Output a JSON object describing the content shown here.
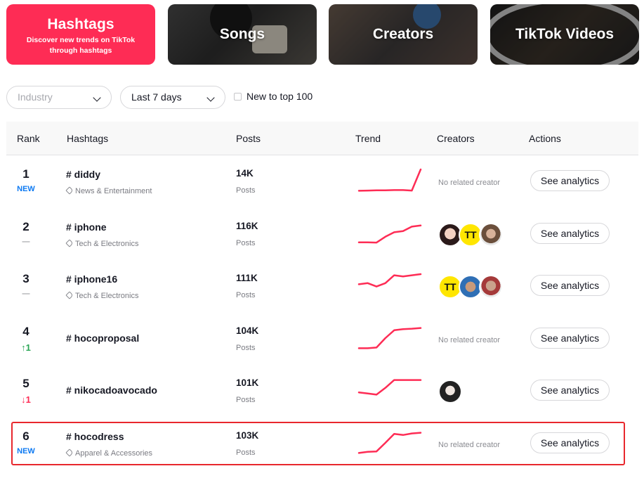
{
  "categories": [
    {
      "title": "Hashtags",
      "subtitle": "Discover new trends on TikTok through hashtags"
    },
    {
      "title": "Songs"
    },
    {
      "title": "Creators"
    },
    {
      "title": "TikTok Videos"
    }
  ],
  "filters": {
    "industry_placeholder": "Industry",
    "period_value": "Last 7 days",
    "new_to_top_label": "New to top 100",
    "new_to_top_checked": false
  },
  "table": {
    "headers": {
      "rank": "Rank",
      "hashtags": "Hashtags",
      "posts": "Posts",
      "trend": "Trend",
      "creators": "Creators",
      "actions": "Actions"
    },
    "posts_label": "Posts",
    "no_creator_text": "No related creator",
    "action_label": "See analytics",
    "rows": [
      {
        "rank": "1",
        "badge": "NEW",
        "badge_type": "new",
        "hashtag": "# diddy",
        "category": "News & Entertainment",
        "posts": "14K",
        "trend": [
          0.05,
          0.06,
          0.07,
          0.07,
          0.08,
          0.08,
          0.06,
          1.0
        ],
        "creators": []
      },
      {
        "rank": "2",
        "badge": "—",
        "badge_type": "same",
        "hashtag": "# iphone",
        "category": "Tech & Electronics",
        "posts": "116K",
        "trend": [
          0.1,
          0.1,
          0.09,
          0.35,
          0.55,
          0.6,
          0.8,
          0.85
        ],
        "creators": [
          "creator-avatar-1",
          "creator-avatar-2",
          "creator-avatar-3"
        ]
      },
      {
        "rank": "3",
        "badge": "—",
        "badge_type": "same",
        "hashtag": "# iphone16",
        "category": "Tech & Electronics",
        "posts": "111K",
        "trend": [
          0.55,
          0.6,
          0.45,
          0.6,
          0.95,
          0.9,
          0.95,
          1.0
        ],
        "creators": [
          "creator-avatar-2",
          "creator-avatar-4",
          "creator-avatar-5"
        ]
      },
      {
        "rank": "4",
        "badge": "↑1",
        "badge_type": "up",
        "hashtag": "# hocoproposal",
        "category": "",
        "posts": "104K",
        "trend": [
          0.05,
          0.05,
          0.08,
          0.5,
          0.85,
          0.9,
          0.92,
          0.95
        ],
        "creators": []
      },
      {
        "rank": "5",
        "badge": "↓1",
        "badge_type": "down",
        "hashtag": "# nikocadoavocado",
        "category": "",
        "posts": "101K",
        "trend": [
          0.4,
          0.35,
          0.3,
          0.6,
          0.95,
          0.95,
          0.95,
          0.95
        ],
        "creators": [
          "creator-avatar-6"
        ]
      },
      {
        "rank": "6",
        "badge": "NEW",
        "badge_type": "new",
        "hashtag": "# hocodress",
        "category": "Apparel & Accessories",
        "posts": "103K",
        "trend": [
          0.05,
          0.1,
          0.12,
          0.5,
          0.9,
          0.85,
          0.92,
          0.95
        ],
        "creators": []
      }
    ]
  },
  "colors": {
    "accent": "#fe2c55",
    "trend_line": "#fe2c55",
    "new_badge": "#0d79f2",
    "up_badge": "#2aa655",
    "down_badge": "#fe2c55",
    "highlight": "#e8272d"
  }
}
